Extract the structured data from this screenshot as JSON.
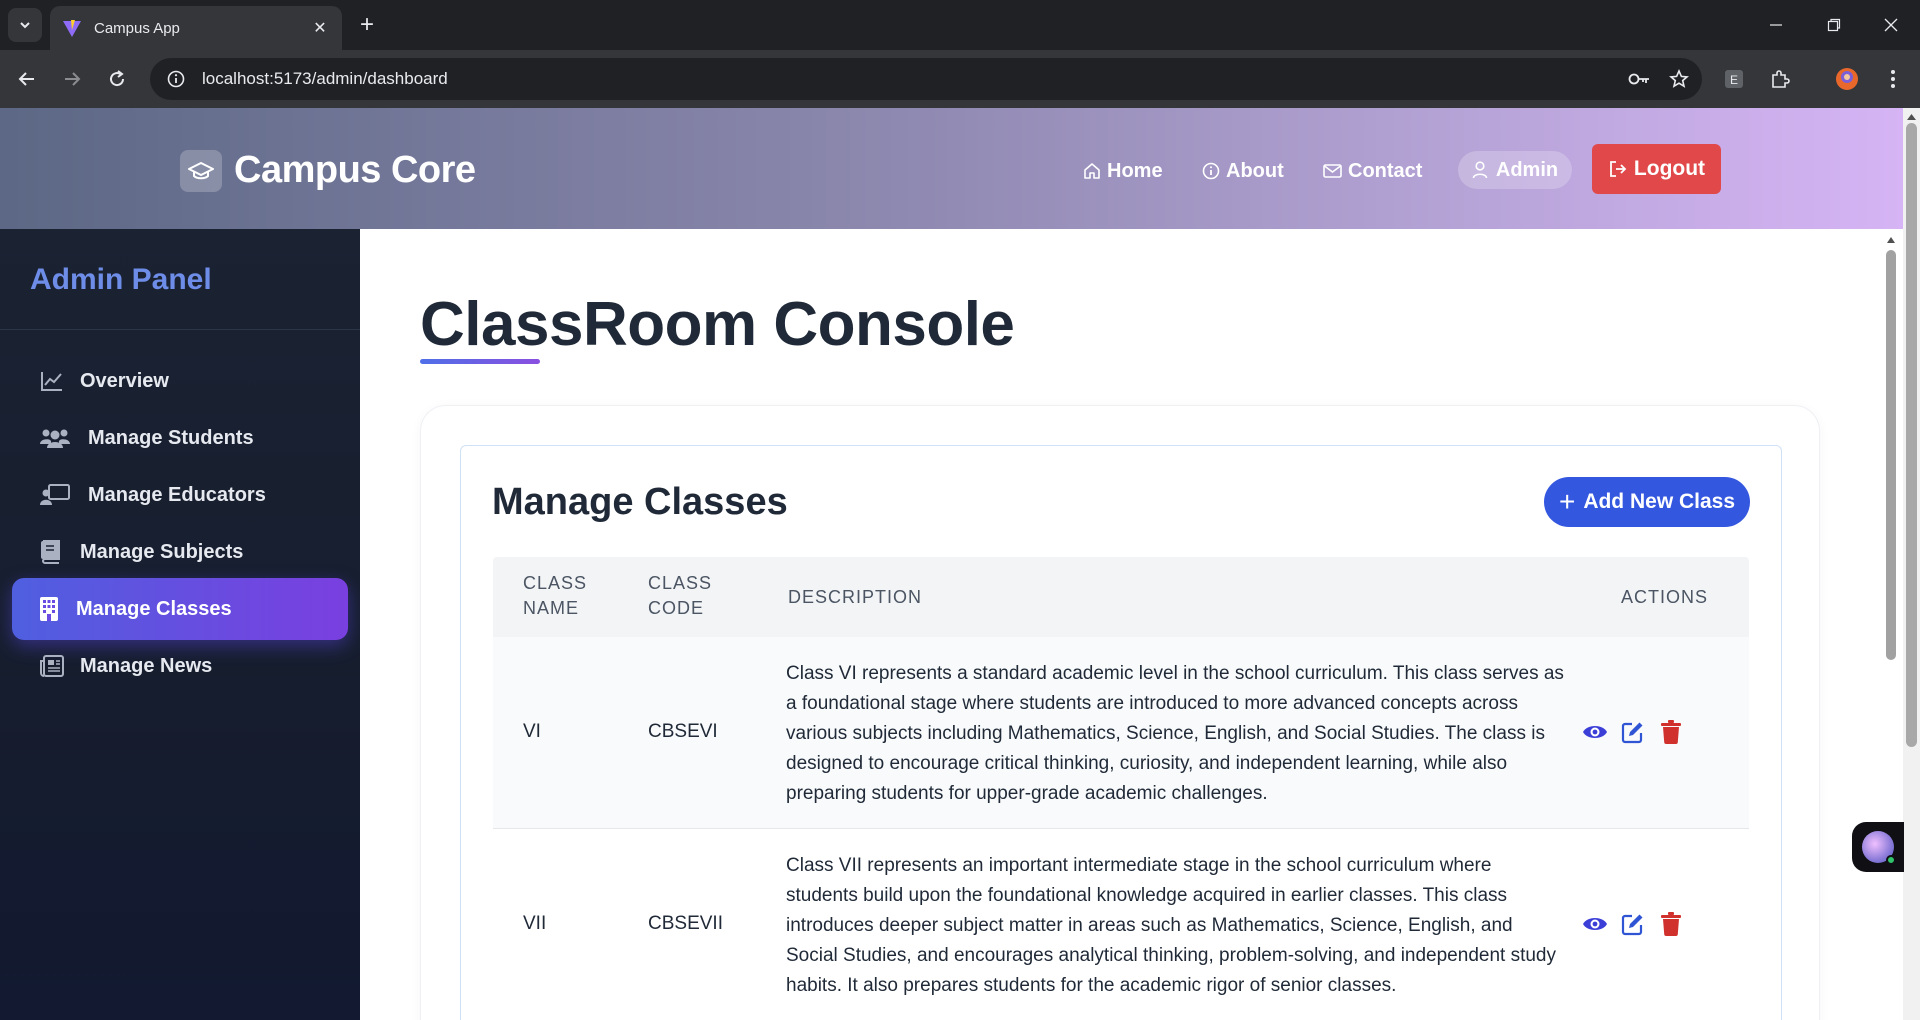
{
  "browser": {
    "tab_title": "Campus App",
    "url": "localhost:5173/admin/dashboard"
  },
  "header": {
    "brand": "Campus Core",
    "nav": [
      {
        "label": "Home",
        "icon": "home-icon"
      },
      {
        "label": "About",
        "icon": "info-icon"
      },
      {
        "label": "Contact",
        "icon": "mail-icon"
      }
    ],
    "admin_label": "Admin",
    "logout_label": "Logout"
  },
  "sidebar": {
    "title": "Admin Panel",
    "items": [
      {
        "label": "Overview",
        "icon": "chart-line-icon",
        "active": false
      },
      {
        "label": "Manage Students",
        "icon": "users-icon",
        "active": false
      },
      {
        "label": "Manage Educators",
        "icon": "chalkboard-teacher-icon",
        "active": false
      },
      {
        "label": "Manage Subjects",
        "icon": "book-icon",
        "active": false
      },
      {
        "label": "Manage Classes",
        "icon": "building-icon",
        "active": true
      },
      {
        "label": "Manage News",
        "icon": "newspaper-icon",
        "active": false
      }
    ]
  },
  "main": {
    "page_title": "ClassRoom Console",
    "section_title": "Manage Classes",
    "add_button": "Add New Class",
    "table": {
      "columns": [
        "CLASS NAME",
        "CLASS CODE",
        "DESCRIPTION",
        "ACTIONS"
      ],
      "col_lines": {
        "class_name": [
          "CLASS",
          "NAME"
        ],
        "class_code": [
          "CLASS",
          "CODE"
        ]
      },
      "rows": [
        {
          "name": "VI",
          "code": "CBSEVI",
          "description": "Class VI represents a standard academic level in the school curriculum. This class serves as a foundational stage where students are introduced to more advanced concepts across various subjects including Mathematics, Science, English, and Social Studies. The class is designed to encourage critical thinking, curiosity, and independent learning, while also preparing students for upper-grade academic challenges."
        },
        {
          "name": "VII",
          "code": "CBSEVII",
          "description": "Class VII represents an important intermediate stage in the school curriculum where students build upon the foundational knowledge acquired in earlier classes. This class introduces deeper subject matter in areas such as Mathematics, Science, English, and Social Studies, and encourages analytical thinking, problem-solving, and independent study habits. It also prepares students for the academic rigor of senior classes."
        }
      ]
    }
  },
  "colors": {
    "accent": "#3457e0",
    "view_icon": "#3b3fd8",
    "edit_icon": "#2f55d4",
    "delete_icon": "#d0312d",
    "logout_bg": "#e0484a"
  }
}
